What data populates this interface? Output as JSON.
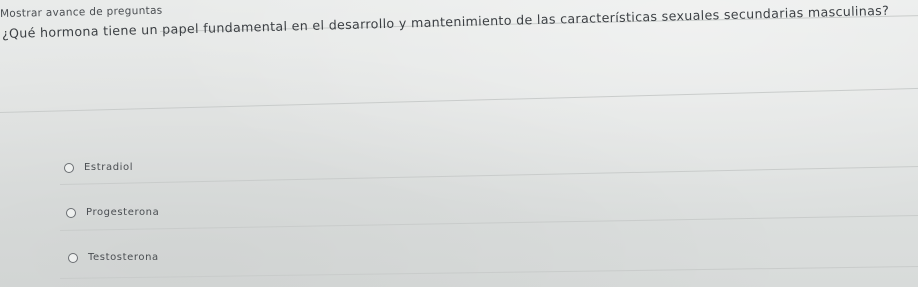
{
  "header": {
    "progress_link": "Mostrar avance de preguntas"
  },
  "quiz": {
    "question": "¿Qué hormona tiene un papel fundamental en el desarrollo y mantenimiento de las características sexuales secundarias masculinas?",
    "options": [
      {
        "label": "Estradiol"
      },
      {
        "label": "Progesterona"
      },
      {
        "label": "Testosterona"
      }
    ]
  },
  "colors": {
    "background": "#e4e6e5",
    "text": "#3b3f43",
    "divider": "#c9cccb"
  }
}
